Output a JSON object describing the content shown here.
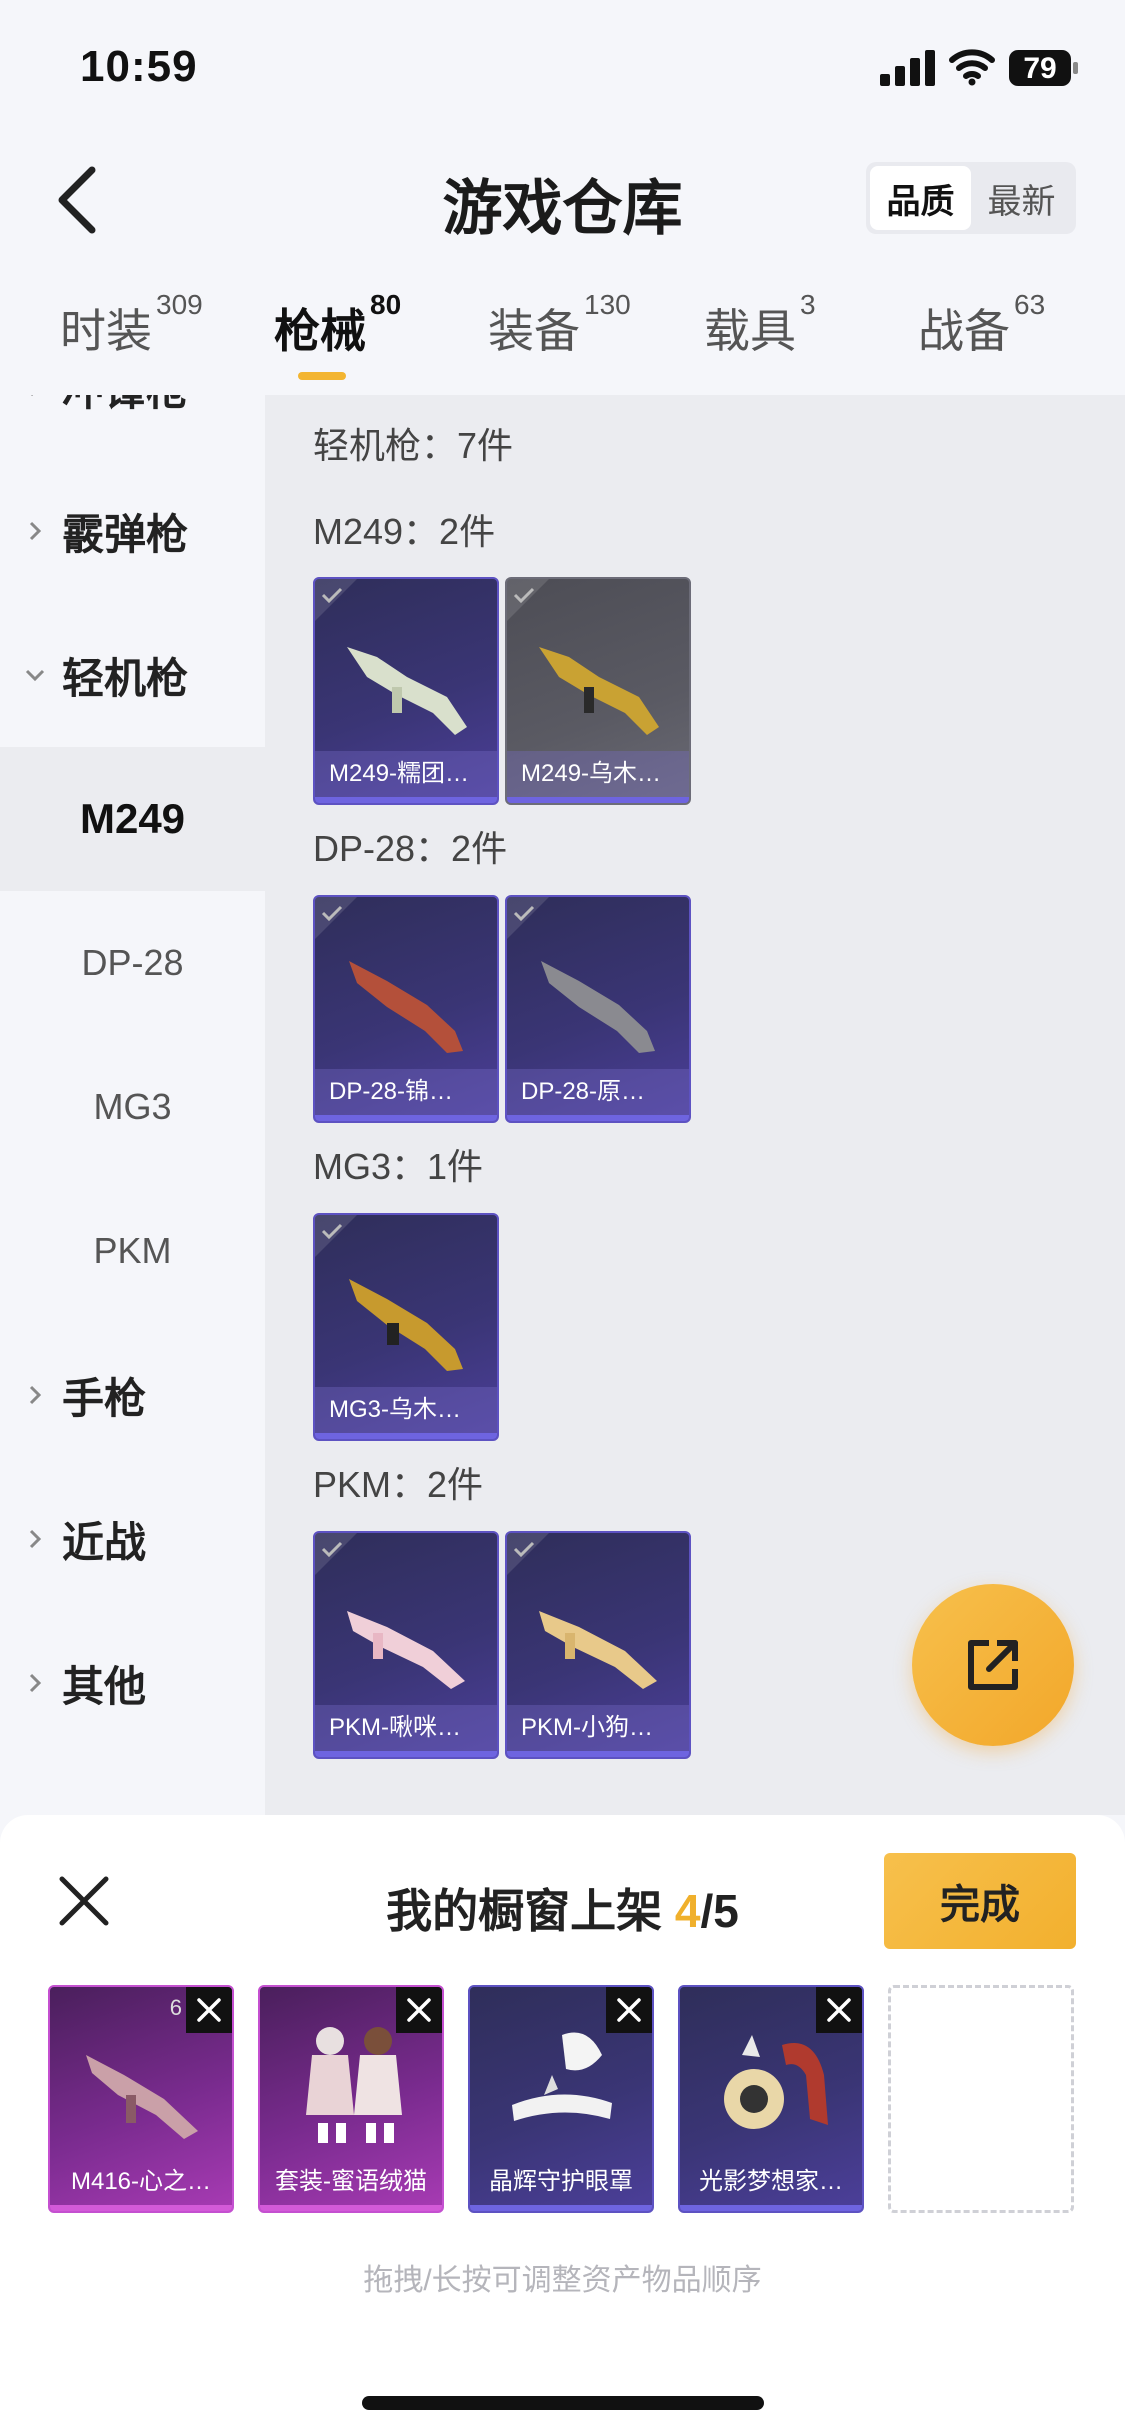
{
  "status": {
    "time": "10:59",
    "battery": "79"
  },
  "header": {
    "title": "游戏仓库",
    "sort": [
      "品质",
      "最新"
    ]
  },
  "tabs": [
    {
      "label": "时装",
      "count": "309"
    },
    {
      "label": "枪械",
      "count": "80"
    },
    {
      "label": "装备",
      "count": "130"
    },
    {
      "label": "载具",
      "count": "3"
    },
    {
      "label": "战备",
      "count": "63"
    }
  ],
  "sidebar": {
    "partial": "冲锋枪",
    "categories": [
      "霰弹枪",
      "轻机枪",
      "手枪",
      "近战",
      "其他"
    ],
    "subs": [
      "M249",
      "DP-28",
      "MG3",
      "PKM"
    ]
  },
  "main": {
    "section_title": "轻机枪：7件",
    "groups": [
      {
        "title": "M249：2件",
        "items": [
          "M249-糯团…",
          "M249-乌木…"
        ]
      },
      {
        "title": "DP-28：2件",
        "items": [
          "DP-28-锦…",
          "DP-28-原…"
        ]
      },
      {
        "title": "MG3：1件",
        "items": [
          "MG3-乌木…"
        ]
      },
      {
        "title": "PKM：2件",
        "items": [
          "PKM-啾咪…",
          "PKM-小狗…"
        ]
      }
    ]
  },
  "sheet": {
    "title_prefix": "我的橱窗上架 ",
    "count": "4",
    "total": "/5",
    "done": "完成",
    "slots": [
      {
        "name": "M416-心之…",
        "tag": "6"
      },
      {
        "name": "套装-蜜语绒猫"
      },
      {
        "name": "晶辉守护眼罩"
      },
      {
        "name": "光影梦想家…"
      }
    ],
    "hint": "拖拽/长按可调整资产物品顺序"
  },
  "colors": {
    "accent": "#f2b02e",
    "item_purple": "#3a3575",
    "item_pink": "#7a2b8f"
  }
}
